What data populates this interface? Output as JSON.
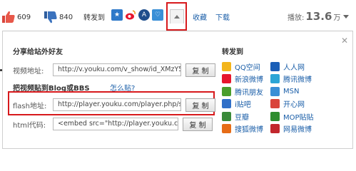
{
  "toolbar": {
    "up_count": "609",
    "down_count": "840",
    "share_label": "转发到",
    "favorite_label": "收藏",
    "download_label": "下载",
    "plays_label": "播放:",
    "plays_value": "13.6",
    "plays_unit": "万",
    "share_icons": [
      "star-icon",
      "weibo-icon",
      "renren-icon",
      "qq-icon"
    ]
  },
  "panel": {
    "share_title": "分享给站外好友",
    "video_url_label": "视频地址:",
    "video_url_value": "http://v.youku.com/v_show/id_XMzY5f",
    "copy_label": "复 制",
    "blog_title": "把视频贴到Blog或BBS",
    "howto_label": "怎么贴?",
    "flash_label": "flash地址:",
    "flash_value": "http://player.youku.com/player.php/si",
    "html_label": "html代码:",
    "html_value": "<embed src=\"http://player.youku.com",
    "forward_title": "转发到",
    "close_glyph": "✕",
    "sites": [
      {
        "name": "QQ空间",
        "icon": "star-icon",
        "color": "#f3b51b"
      },
      {
        "name": "人人网",
        "icon": "renren-icon",
        "color": "#1b5fb7"
      },
      {
        "name": "新浪微博",
        "icon": "weibo-icon",
        "color": "#e6162d"
      },
      {
        "name": "腾讯微博",
        "icon": "tencent-weibo-icon",
        "color": "#2ba5d6"
      },
      {
        "name": "腾讯朋友",
        "icon": "pengyou-icon",
        "color": "#4a9d2b"
      },
      {
        "name": "MSN",
        "icon": "msn-icon",
        "color": "#3a8fd6"
      },
      {
        "name": "i贴吧",
        "icon": "tieba-icon",
        "color": "#2f6fc8"
      },
      {
        "name": "开心网",
        "icon": "kaixin-icon",
        "color": "#d9453b"
      },
      {
        "name": "豆瓣",
        "icon": "douban-icon",
        "color": "#3a8a3a"
      },
      {
        "name": "MOP贴贴",
        "icon": "mop-icon",
        "color": "#2f8d2f"
      },
      {
        "name": "搜狐微博",
        "icon": "sohu-icon",
        "color": "#e66c17"
      },
      {
        "name": "网易微博",
        "icon": "netease-icon",
        "color": "#c2272d"
      }
    ]
  },
  "colors": {
    "highlight": "#d7191c",
    "link": "#1a5ea8"
  }
}
